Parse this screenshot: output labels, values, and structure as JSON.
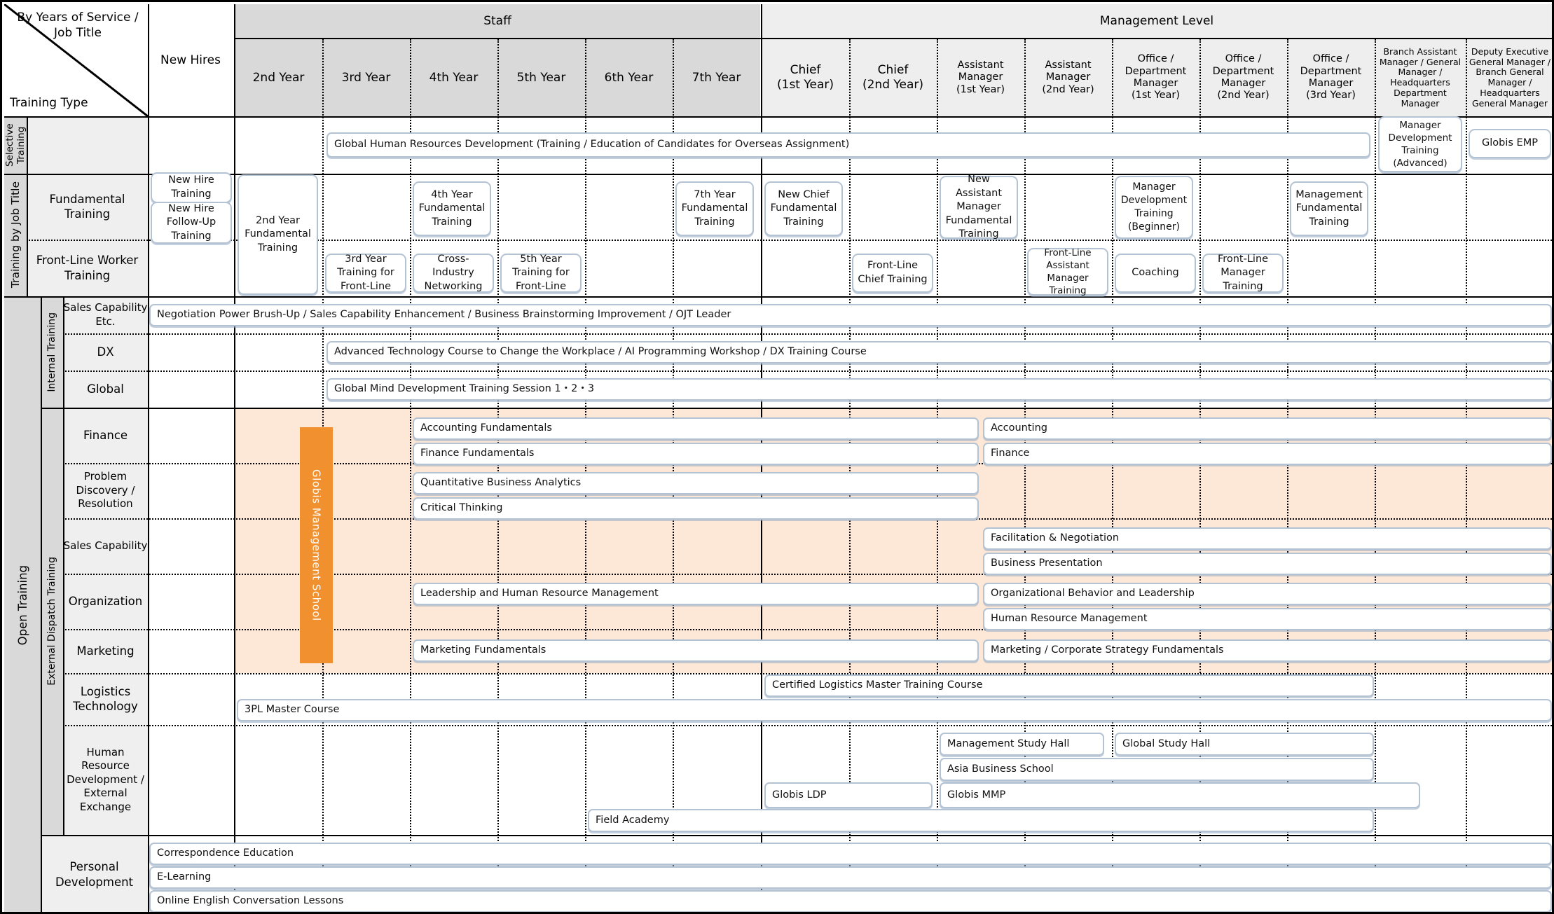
{
  "corner": {
    "top_right_label": "By Years of Service / Job Title",
    "bottom_left_label": "Training Type"
  },
  "columns": {
    "new_hires": "New Hires",
    "group_staff": "Staff",
    "group_management": "Management Level",
    "staff": [
      "2nd Year",
      "3rd Year",
      "4th Year",
      "5th Year",
      "6th Year",
      "7th Year"
    ],
    "management": [
      "Chief\n(1st Year)",
      "Chief\n(2nd Year)",
      "Assistant Manager\n(1st Year)",
      "Assistant Manager\n(2nd Year)",
      "Office / Department Manager\n(1st Year)",
      "Office / Department Manager\n(2nd Year)",
      "Office / Department Manager\n(3rd Year)",
      "Branch Assistant Manager / General Manager / Headquarters Department Manager",
      "Deputy Executive General Manager / Branch General Manager / Headquarters General Manager"
    ]
  },
  "row_groups": {
    "selective_training": "Selective Training",
    "training_by_job_title": "Training by Job Title",
    "open_training": "Open Training",
    "internal_training": "Internal Training",
    "external_dispatch_training": "External Dispatch Training"
  },
  "rows": {
    "fundamental_training": "Fundamental Training",
    "front_line_worker_training": "Front-Line Worker Training",
    "sales_capability_etc": "Sales Capability Etc.",
    "dx": "DX",
    "global": "Global",
    "finance": "Finance",
    "problem_discovery": "Problem Discovery / Resolution",
    "sales_capability": "Sales Capability",
    "organization": "Organization",
    "marketing": "Marketing",
    "logistics_technology": "Logistics Technology",
    "hr_development": "Human Resource Development / External Exchange",
    "personal_development": "Personal Development"
  },
  "programs": {
    "global_hr_development": "Global Human Resources Development (Training / Education of Candidates for Overseas Assignment)",
    "manager_dev_advanced": "Manager Development Training (Advanced)",
    "globis_emp": "Globis EMP",
    "new_hire_training": "New Hire Training",
    "new_hire_follow_up": "New Hire Follow-Up Training",
    "second_year_fundamental": "2nd Year Fundamental Training",
    "fourth_year_fundamental": "4th Year Fundamental Training",
    "seventh_year_fundamental": "7th Year Fundamental Training",
    "new_chief_fundamental": "New Chief Fundamental Training",
    "new_assistant_manager_fundamental": "New Assistant Manager Fundamental Training",
    "manager_dev_beginner": "Manager Development Training (Beginner)",
    "management_fundamental": "Management Fundamental Training",
    "third_year_front_line": "3rd Year Training for Front-Line",
    "cross_industry_networking": "Cross-Industry Networking",
    "fifth_year_front_line": "5th Year Training for Front-Line",
    "front_line_chief": "Front-Line Chief Training",
    "front_line_assistant_manager": "Front-Line Assistant Manager Training",
    "coaching": "Coaching",
    "front_line_manager": "Front-Line Manager Training",
    "negotiation_power": "Negotiation Power Brush-Up / Sales Capability Enhancement / Business Brainstorming Improvement / OJT Leader",
    "advanced_technology": "Advanced Technology Course to Change the Workplace / AI Programming Workshop / DX Training Course",
    "global_mind": "Global Mind Development Training Session 1・2・3",
    "globis_management_school": "Globis Management School",
    "accounting_fundamentals": "Accounting Fundamentals",
    "finance_fundamentals": "Finance Fundamentals",
    "accounting": "Accounting",
    "finance_course": "Finance",
    "quantitative_business_analytics": "Quantitative Business Analytics",
    "critical_thinking": "Critical Thinking",
    "facilitation_negotiation": "Facilitation & Negotiation",
    "business_presentation": "Business Presentation",
    "leadership_hr_management": "Leadership and Human Resource Management",
    "organizational_behavior": "Organizational Behavior and Leadership",
    "human_resource_management": "Human Resource Management",
    "marketing_fundamentals": "Marketing Fundamentals",
    "marketing_corporate_strategy": "Marketing / Corporate Strategy Fundamentals",
    "certified_logistics_master": "Certified Logistics Master Training Course",
    "three_pl_master": "3PL Master Course",
    "management_study_hall": "Management Study Hall",
    "global_study_hall": "Global Study Hall",
    "asia_business_school": "Asia Business School",
    "globis_ldp": "Globis LDP",
    "globis_mmp": "Globis MMP",
    "field_academy": "Field Academy",
    "correspondence_education": "Correspondence Education",
    "e_learning": "E-Learning",
    "online_english": "Online English Conversation Lessons"
  },
  "colors": {
    "header_gray": "#d9d9d9",
    "header_light": "#eeeeee",
    "box_border": "#b4c3d4",
    "accent_orange": "#f0902f",
    "peach_background": "#fde8d7"
  }
}
